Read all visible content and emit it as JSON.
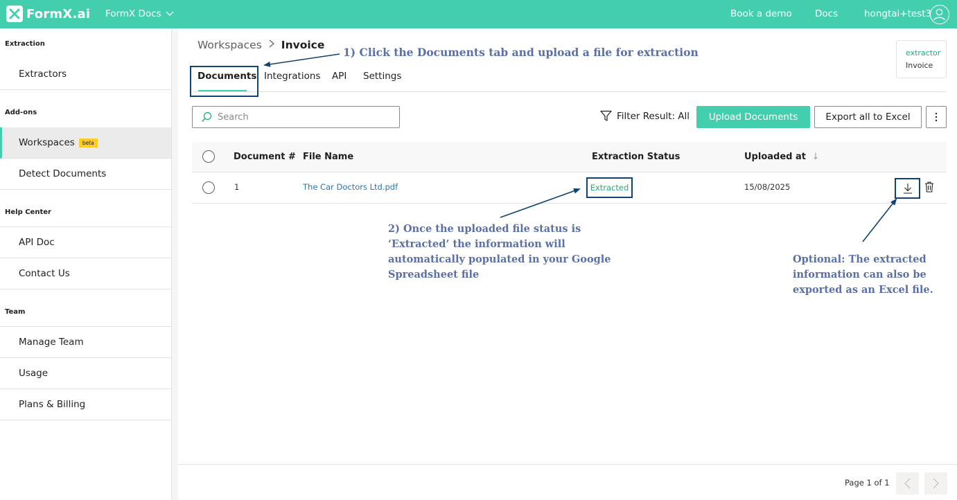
{
  "topbar": {
    "logo_text": "FormX.ai",
    "app_switcher": "FormX Docs",
    "links": [
      "Book a demo",
      "Docs"
    ],
    "user": "hongtai+test3",
    "icons": [
      "formx-logo-icon",
      "chevron-down-icon",
      "user-avatar-icon"
    ]
  },
  "sidebar": {
    "sections": [
      {
        "title": "Extraction",
        "items": [
          "Extractors"
        ]
      },
      {
        "title": "Add-ons",
        "items": [
          "Workspaces",
          "Detect Documents"
        ]
      },
      {
        "title": "Help Center",
        "items": [
          "API Doc",
          "Contact Us"
        ]
      },
      {
        "title": "Team",
        "items": [
          "Manage Team",
          "Usage",
          "Plans & Billing"
        ]
      }
    ],
    "active_item": "Workspaces",
    "beta_badge": "beta"
  },
  "breadcrumb": {
    "parent": "Workspaces",
    "current": "Invoice"
  },
  "tabs": [
    "Documents",
    "Integrations",
    "API",
    "Settings"
  ],
  "active_tab": "Documents",
  "info_card": {
    "type": "extractor",
    "name": "Invoice"
  },
  "toolbar": {
    "search_placeholder": "Search",
    "filter_label": "Filter Result: All",
    "upload_label": "Upload Documents",
    "export_label": "Export all to Excel"
  },
  "table": {
    "columns": [
      "Document #",
      "File Name",
      "Extraction Status",
      "Uploaded at"
    ],
    "sort_indicator": "↓",
    "rows": [
      {
        "number": "1",
        "file_name": "The Car Doctors Ltd.pdf",
        "status": "Extracted",
        "uploaded_at": "15/08/2025"
      }
    ]
  },
  "pagination": {
    "label": "Page 1 of 1"
  },
  "annotations": {
    "step1": "1) Click the Documents tab and upload a file for extraction",
    "step2_lines": [
      "2) Once the uploaded file status is",
      "‘Extracted’ the information will",
      "automatically populated in your Google",
      "Spreadsheet file"
    ],
    "optional_lines": [
      "Optional: The extracted",
      "information can also be",
      "exported as an Excel file."
    ]
  },
  "colors": {
    "brand": "#43cfae",
    "status_green": "#25a87e",
    "link_blue": "#2577b8",
    "annotation": "#5b6fa8",
    "highlight_box": "#12426f"
  }
}
